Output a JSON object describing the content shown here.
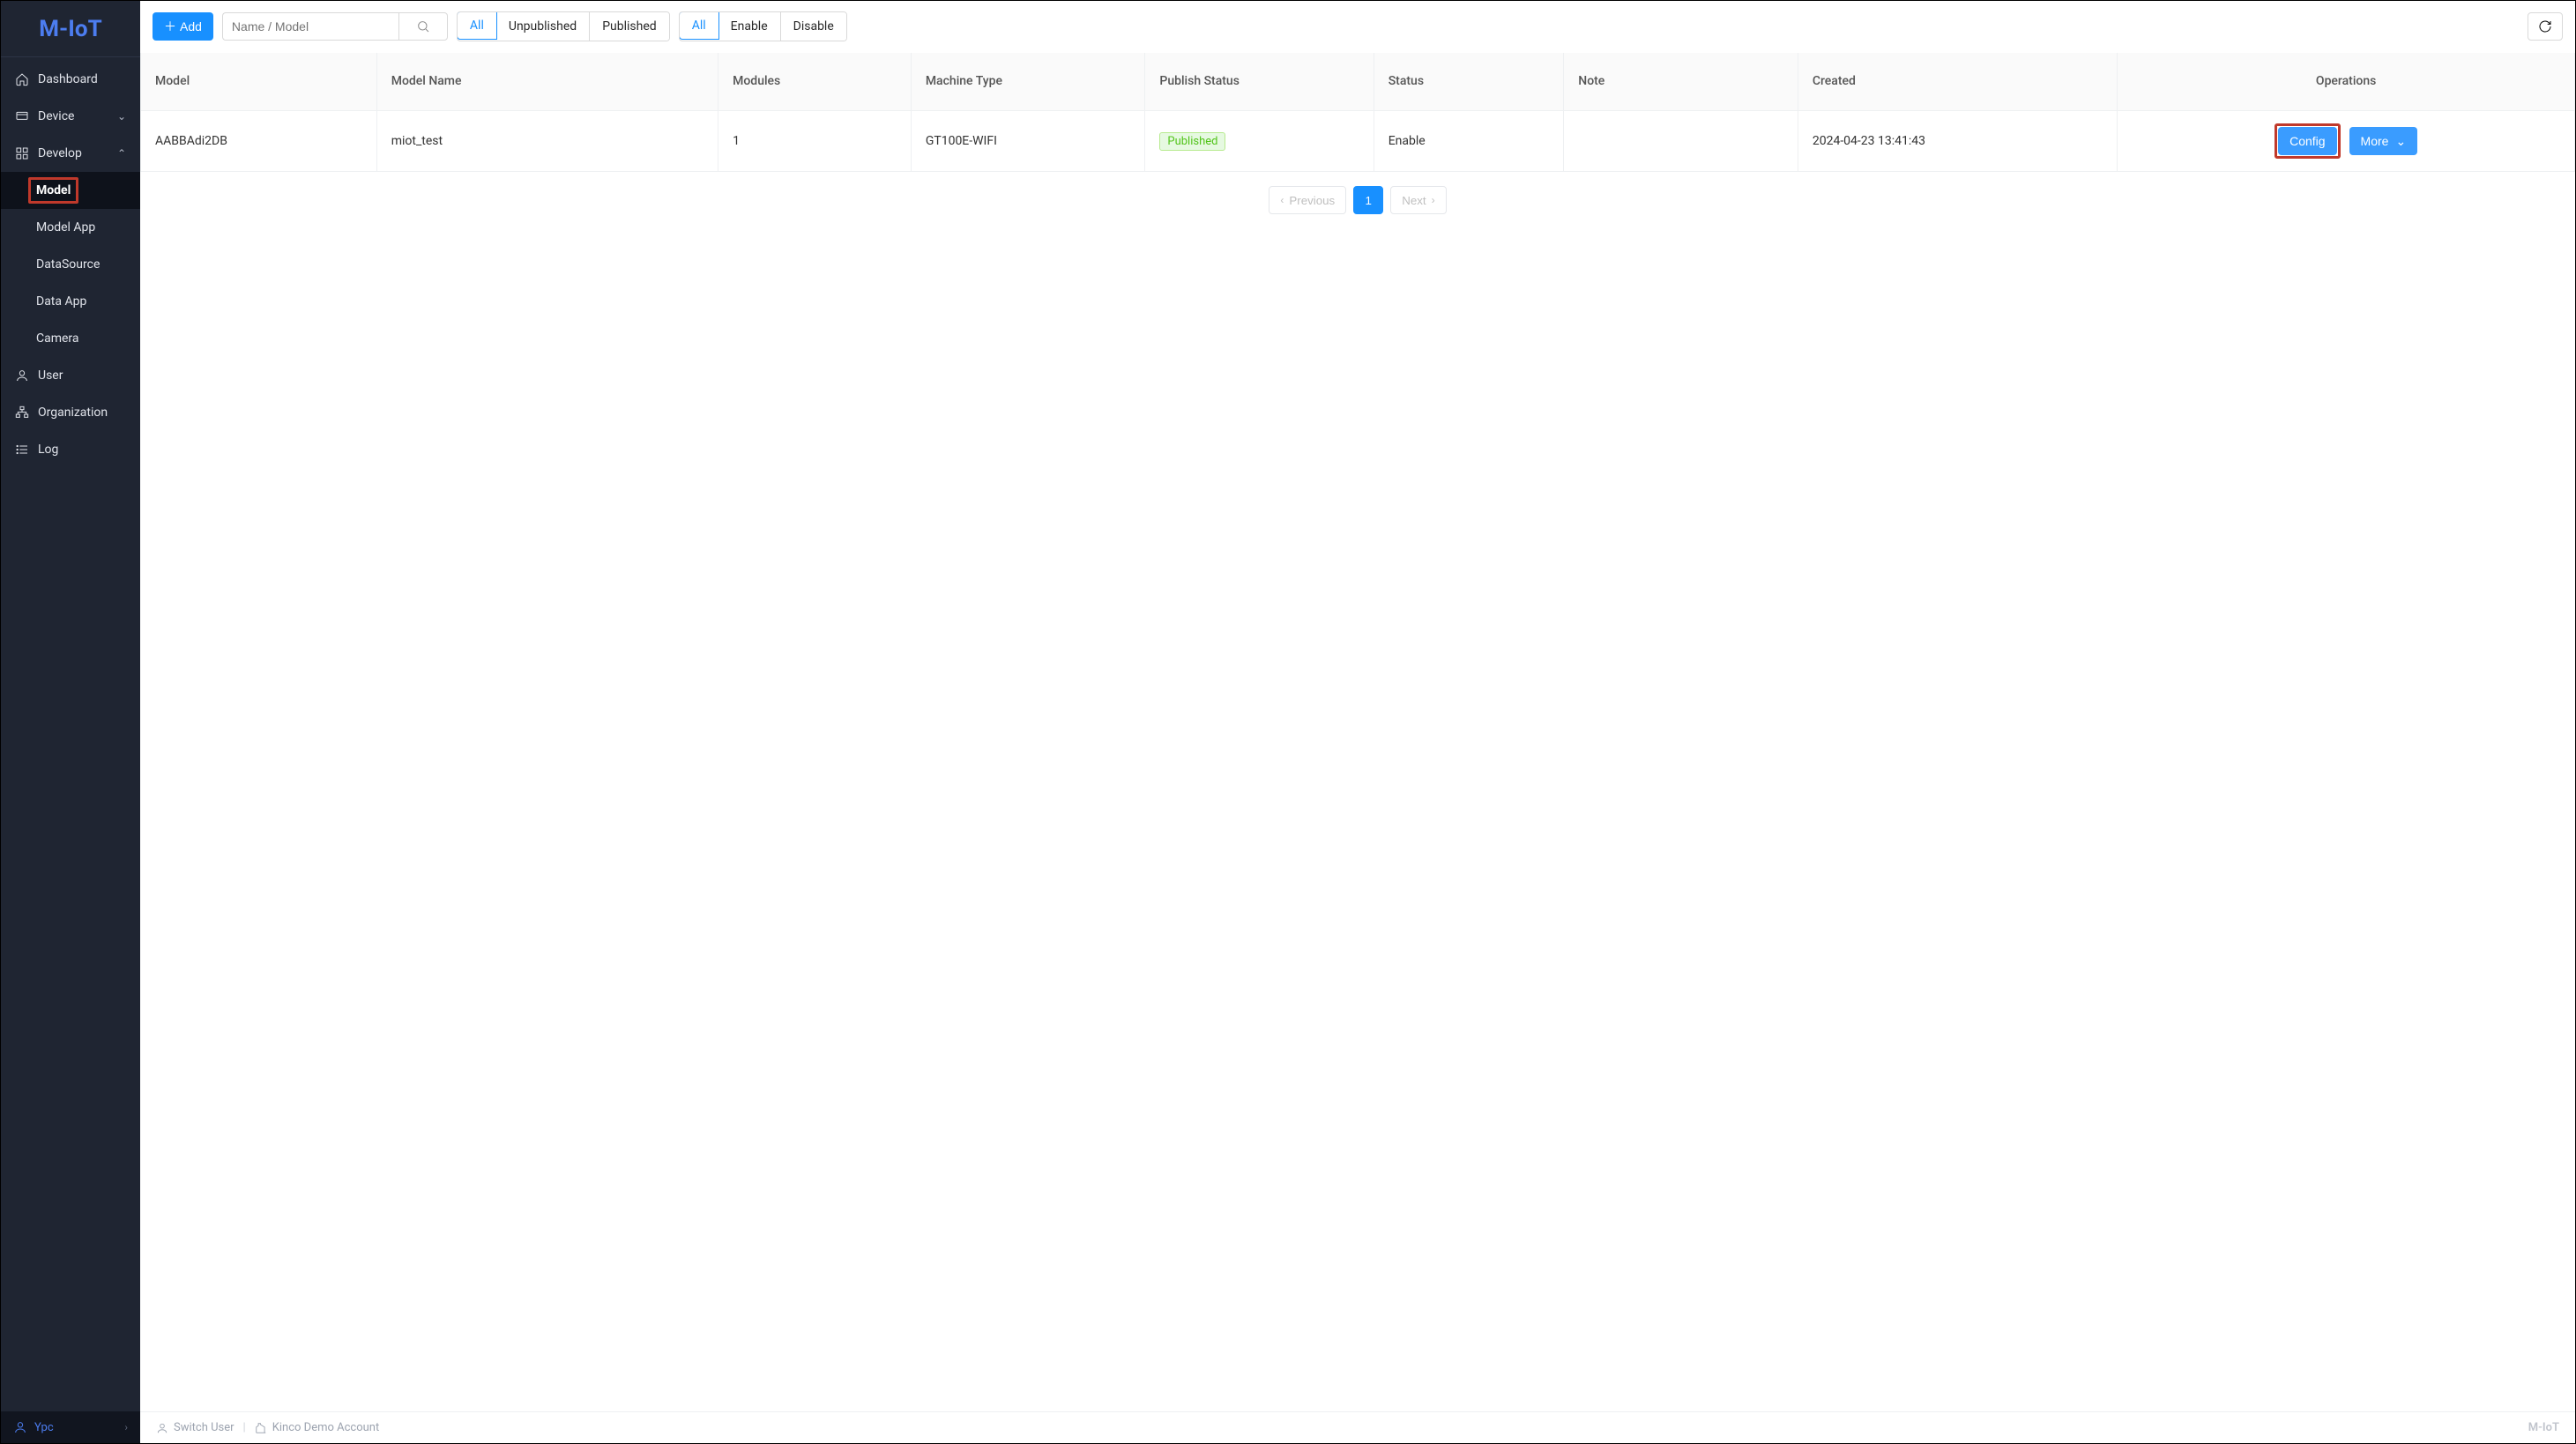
{
  "brand": "M-IoT",
  "sidebar": {
    "items": [
      {
        "key": "dashboard",
        "label": "Dashboard"
      },
      {
        "key": "device",
        "label": "Device"
      },
      {
        "key": "develop",
        "label": "Develop"
      },
      {
        "key": "user",
        "label": "User"
      },
      {
        "key": "organization",
        "label": "Organization"
      },
      {
        "key": "log",
        "label": "Log"
      }
    ],
    "develop_children": [
      {
        "key": "model",
        "label": "Model"
      },
      {
        "key": "model-app",
        "label": "Model App"
      },
      {
        "key": "datasource",
        "label": "DataSource"
      },
      {
        "key": "data-app",
        "label": "Data App"
      },
      {
        "key": "camera",
        "label": "Camera"
      }
    ],
    "footer_user": "Ypc"
  },
  "toolbar": {
    "add_label": "Add",
    "search_placeholder": "Name / Model",
    "publish_filter": {
      "options": [
        "All",
        "Unpublished",
        "Published"
      ],
      "active": "All"
    },
    "status_filter": {
      "options": [
        "All",
        "Enable",
        "Disable"
      ],
      "active": "All"
    }
  },
  "table": {
    "columns": {
      "model": "Model",
      "model_name": "Model Name",
      "modules": "Modules",
      "machine_type": "Machine Type",
      "publish_status": "Publish Status",
      "status": "Status",
      "note": "Note",
      "created": "Created",
      "operations": "Operations"
    },
    "rows": [
      {
        "model": "AABBAdi2DB",
        "model_name": "miot_test",
        "modules": "1",
        "machine_type": "GT100E-WIFI",
        "publish_status": "Published",
        "status": "Enable",
        "note": "",
        "created": "2024-04-23 13:41:43"
      }
    ],
    "ops": {
      "config": "Config",
      "more": "More"
    }
  },
  "pagination": {
    "previous": "Previous",
    "next": "Next",
    "page": "1"
  },
  "footer": {
    "switch_user": "Switch User",
    "account": "Kinco Demo Account",
    "brand": "M-IoT"
  }
}
